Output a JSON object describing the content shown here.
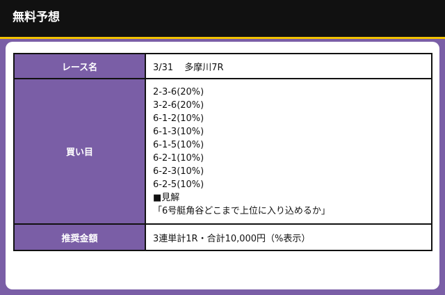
{
  "header": {
    "title": "無料予想"
  },
  "table": {
    "race_label": "レース名",
    "race_date": "3/31",
    "race_name": "多摩川7R",
    "bets_label": "買い目",
    "bets": [
      "2-3-6(20%)",
      "3-2-6(20%)",
      "6-1-2(10%)",
      "6-1-3(10%)",
      "6-1-5(10%)",
      "6-2-1(10%)",
      "6-2-3(10%)",
      "6-2-5(10%)"
    ],
    "opinion_heading": "■見解",
    "opinion_text": "「6号艇角谷どこまで上位に入り込めるか」",
    "amount_label": "推奨金額",
    "amount_value": "3連単計1R・合計10,000円（%表示）"
  },
  "colors": {
    "accent_purple": "#7a5ea6",
    "header_bg": "#111111",
    "header_underline": "#f2c200"
  }
}
